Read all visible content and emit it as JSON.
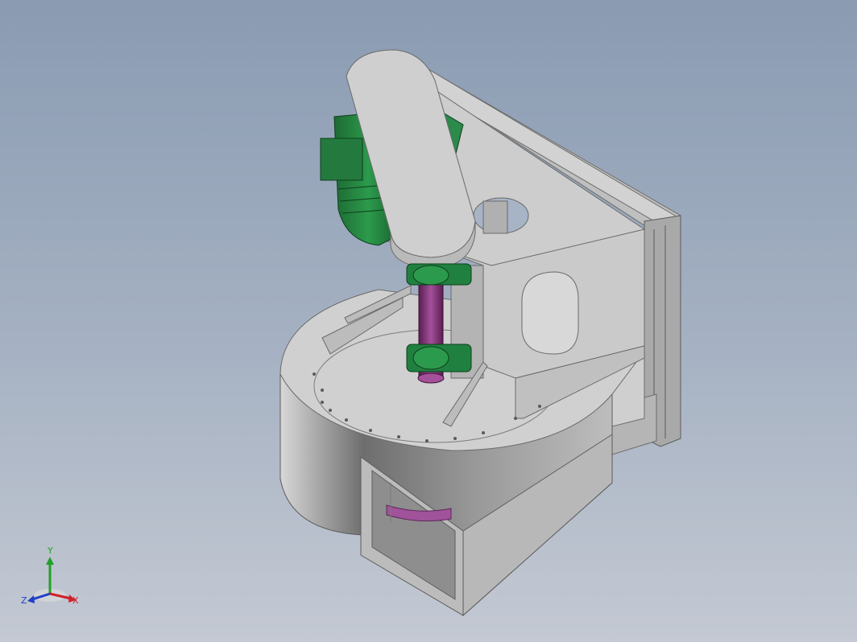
{
  "viewport": {
    "background_top": "#8a9bb2",
    "background_bottom": "#c4c9d3"
  },
  "model": {
    "body_color": "#c4c4c4",
    "motor_color": "#1e7a3c",
    "shaft_color": "#8b3a7a",
    "impeller_color": "#a0529a"
  },
  "triad": {
    "x_label": "X",
    "y_label": "Y",
    "z_label": "Z",
    "x_color": "#d0202a",
    "y_color": "#22a02a",
    "z_color": "#1f3fc8"
  }
}
